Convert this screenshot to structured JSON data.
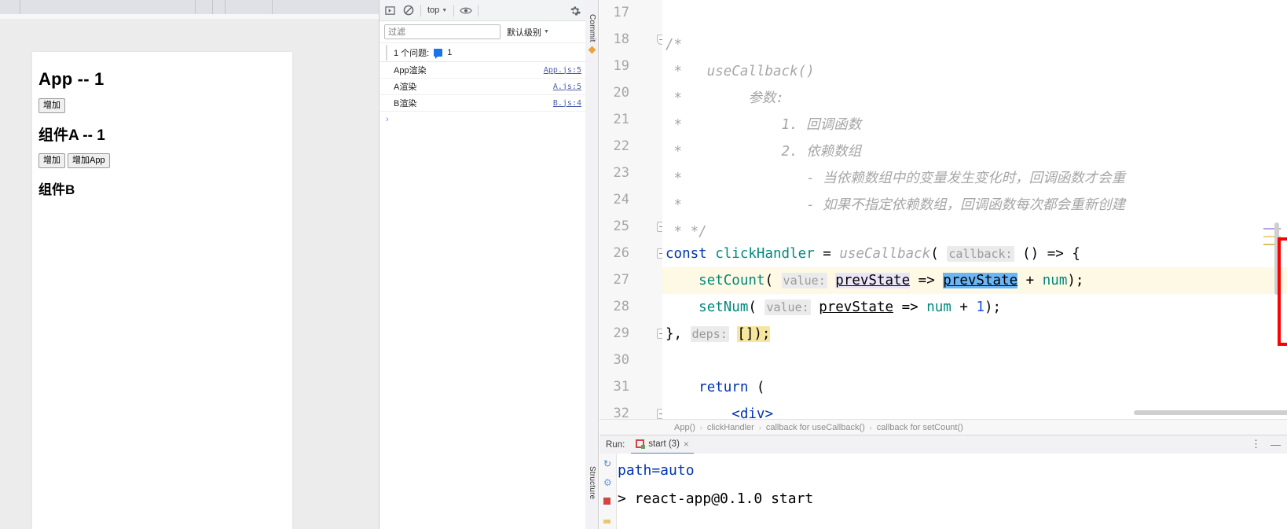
{
  "browser": {
    "toolbar_segments": 5,
    "page": {
      "app_heading": "App -- 1",
      "app_button": "增加",
      "component_a_heading": "组件A -- 1",
      "a_button_1": "增加",
      "a_button_2": "增加App",
      "component_b_heading": "组件B"
    }
  },
  "devtools": {
    "icons": {
      "inspect": "inspect-icon",
      "clear": "clear-console-icon",
      "eye": "eye-icon",
      "gear": "gear-icon",
      "caret": "▼"
    },
    "context_selector": "top",
    "filter_placeholder": "过滤",
    "filter_value": "",
    "level_selector": "默认级别",
    "issues_label": "1 个问题:",
    "issues_count": "1",
    "messages": [
      {
        "text": "App渲染",
        "source": "App.js:5"
      },
      {
        "text": "A渲染",
        "source": "A.js:5"
      },
      {
        "text": "B渲染",
        "source": "B.js:4"
      }
    ],
    "prompt_symbol": "›"
  },
  "ide": {
    "left_tool_window": "Commit",
    "bottom_tool_window": "Structure",
    "editor": {
      "first_line_number": 17,
      "lines": [
        {
          "n": 17,
          "text": ""
        },
        {
          "n": 18,
          "text": "/*"
        },
        {
          "n": 19,
          "text": " *   useCallback()"
        },
        {
          "n": 20,
          "text": " *        参数:"
        },
        {
          "n": 21,
          "text": " *            1. 回调函数"
        },
        {
          "n": 22,
          "text": " *            2. 依赖数组"
        },
        {
          "n": 23,
          "text": " *               - 当依赖数组中的变量发生变化时，回调函数才会重"
        },
        {
          "n": 24,
          "text": " *               - 如果不指定依赖数组，回调函数每次都会重新创建"
        },
        {
          "n": 25,
          "text": " * */"
        },
        {
          "n": 26,
          "text": "const clickHandler = useCallback( callback: () => {"
        },
        {
          "n": 27,
          "text": "    setCount( value: prevState => prevState + num);"
        },
        {
          "n": 28,
          "text": "    setNum( value: prevState => num + 1);"
        },
        {
          "n": 29,
          "text": "}, deps: []);"
        },
        {
          "n": 30,
          "text": ""
        },
        {
          "n": 31,
          "text": "    return ("
        },
        {
          "n": 32,
          "text": "        <div>"
        }
      ],
      "code": {
        "l26": {
          "kw": "const",
          "name": "clickHandler",
          "eq": "=",
          "fn": "useCallback",
          "open": "(",
          "hint": "callback:",
          "rest": "() => {"
        },
        "l27": {
          "fn": "setCount",
          "open": "(",
          "hint": "value:",
          "p1": "prevState",
          "arrow": "=>",
          "p2": "prevState",
          "plus": "+",
          "p3": "num",
          "close": ");"
        },
        "l28": {
          "fn": "setNum",
          "open": "(",
          "hint": "value:",
          "p1": "prevState",
          "arrow": "=>",
          "p2": "num",
          "plus": "+",
          "num": "1",
          "close": ");"
        },
        "l29": {
          "brace": "},",
          "hint": "deps:",
          "rest": "[]);"
        },
        "l31": {
          "kw": "return",
          "rest": "("
        },
        "l32": {
          "tag": "<div>"
        }
      },
      "highlight_box_color": "#ff0000",
      "current_line": 27,
      "bulb": "intention-bulb-icon"
    },
    "breadcrumb": [
      "App()",
      "clickHandler",
      "callback for useCallback()",
      "callback for setCount()"
    ],
    "breadcrumb_sep": "›",
    "run": {
      "label": "Run:",
      "tab_title": "start (3)",
      "tab_close": "×",
      "more_icon": "⋮",
      "minimize_icon": "—",
      "gutter_icons": [
        "rerun-icon",
        "settings-icon",
        "stop-icon"
      ],
      "output": [
        {
          "text": "path=auto",
          "style": "blue"
        },
        {
          "text": "> react-app@0.1.0 start",
          "style": "plain"
        }
      ]
    }
  },
  "colors": {
    "accent_red": "#ff0000",
    "keyword_blue": "#0033b3",
    "function_teal": "#00897b",
    "comment_gray": "#a6a6a6",
    "highlight_yellow": "#fdf9e5",
    "usage_blue": "#6cb6f5",
    "usage_purple": "#ebe6f7"
  }
}
